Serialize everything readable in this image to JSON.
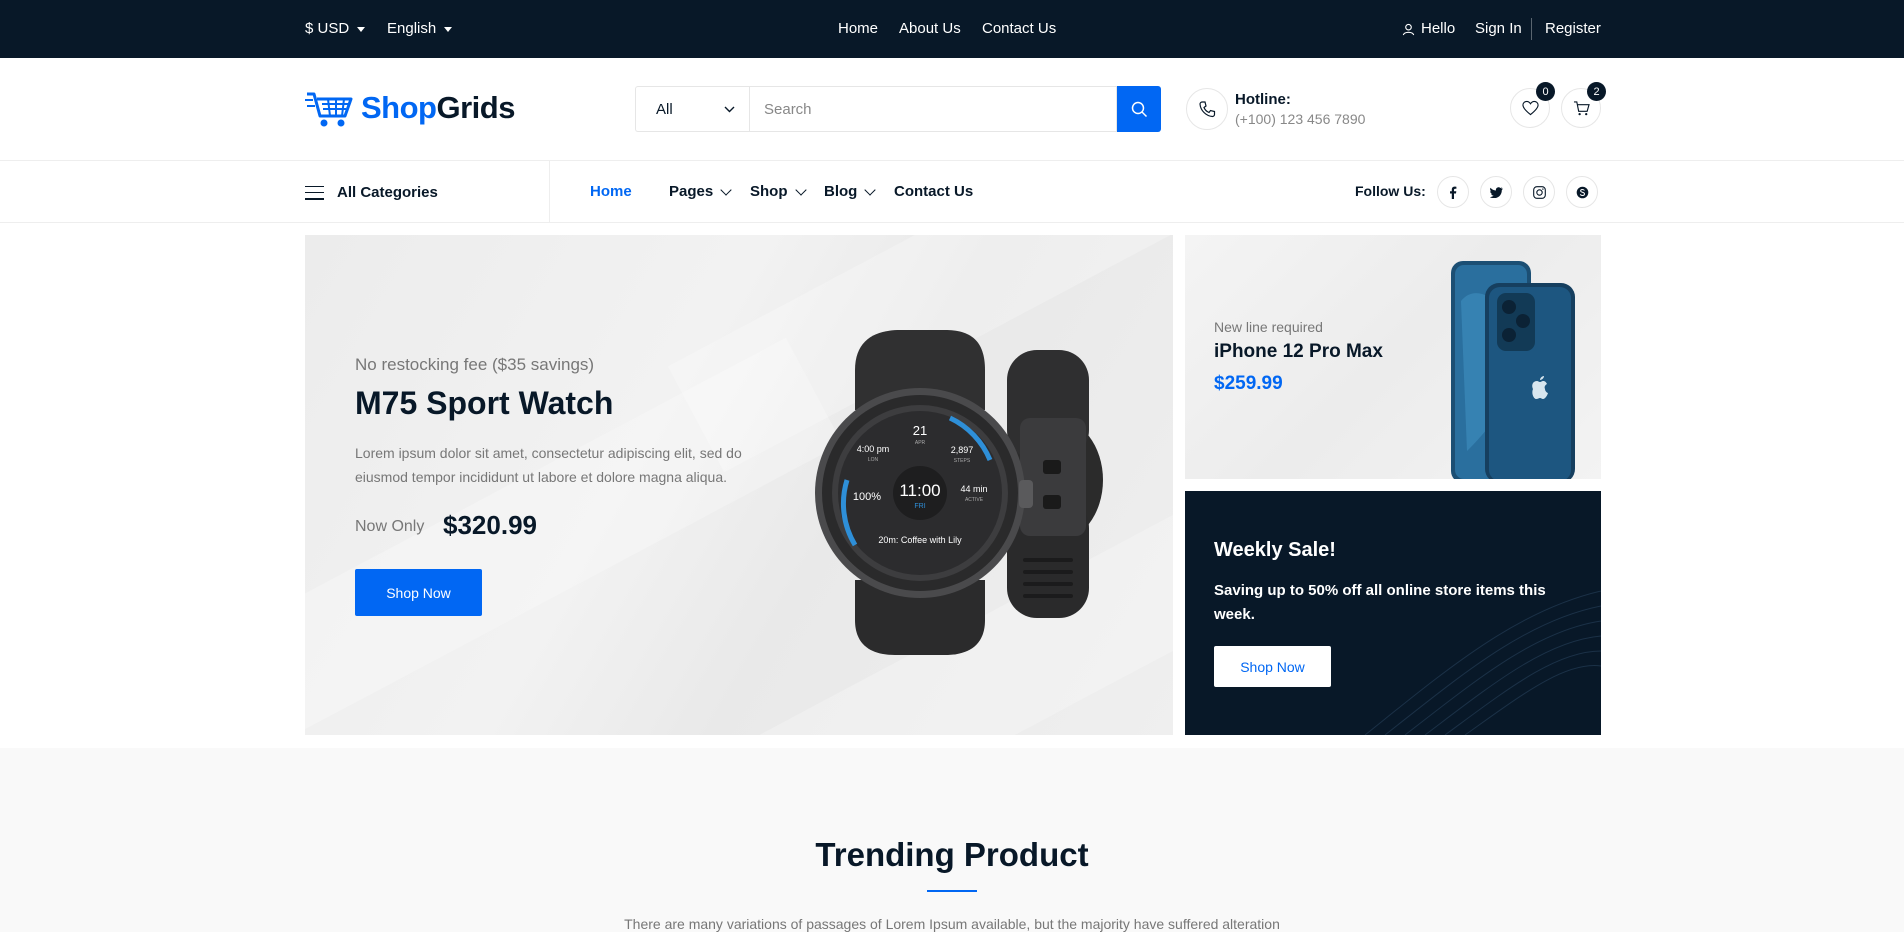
{
  "topbar": {
    "currency": "$ USD",
    "language": "English",
    "nav": [
      "Home",
      "About Us",
      "Contact Us"
    ],
    "hello": "Hello",
    "sign_in": "Sign In",
    "register": "Register"
  },
  "header": {
    "logo_part1": "Shop",
    "logo_part2": "Grids",
    "search_category": "All",
    "search_placeholder": "Search",
    "hotline_label": "Hotline:",
    "hotline_number": "(+100) 123 456 7890",
    "wishlist_count": "0",
    "cart_count": "2"
  },
  "nav": {
    "all_categories": "All Categories",
    "links": [
      "Home",
      "Pages",
      "Shop",
      "Blog",
      "Contact Us"
    ],
    "follow_us": "Follow Us:"
  },
  "hero": {
    "subtitle": "No restocking fee ($35 savings)",
    "title": "M75 Sport Watch",
    "description": "Lorem ipsum dolor sit amet, consectetur adipiscing elit, sed do eiusmod tempor incididunt ut labore et dolore magna aliqua.",
    "now_only": "Now Only",
    "price": "$320.99",
    "button": "Shop Now",
    "watch_face": {
      "time": "11:00",
      "day": "FRI",
      "date": "21",
      "month": "APR",
      "left_time": "4:00 pm",
      "left_label": "LON",
      "steps": "2,897",
      "steps_label": "STEPS",
      "battery": "100%",
      "active": "44 min",
      "active_label": "ACTIVE",
      "event": "20m: Coffee with Lily"
    }
  },
  "iphone_banner": {
    "subtitle": "New line required",
    "title": "iPhone 12 Pro Max",
    "price": "$259.99"
  },
  "weekly_banner": {
    "title": "Weekly Sale!",
    "description": "Saving up to 50% off all online store items this week.",
    "button": "Shop Now"
  },
  "trending": {
    "title": "Trending Product",
    "description": "There are many variations of passages of Lorem Ipsum available, but the majority have suffered alteration"
  },
  "colors": {
    "primary": "#0167f3",
    "dark": "#081828",
    "muted": "#777777"
  }
}
